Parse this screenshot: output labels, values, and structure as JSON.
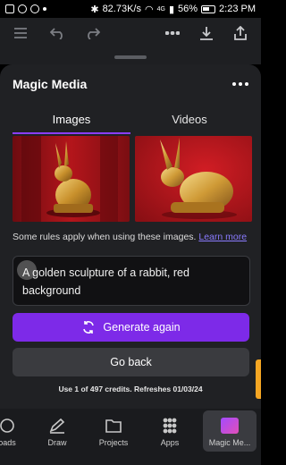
{
  "status_bar": {
    "speed": "82.73K/s",
    "network": "4G",
    "battery": "56%",
    "time": "2:23 PM"
  },
  "toolbar": {
    "icons": [
      "menu-icon",
      "undo-icon",
      "redo-icon",
      "more-icon",
      "download-icon",
      "share-icon"
    ]
  },
  "sheet": {
    "title": "Magic Media",
    "tabs": [
      {
        "label": "Images",
        "active": true
      },
      {
        "label": "Videos",
        "active": false
      }
    ],
    "rules_text": "Some rules apply when using these images.",
    "learn_more": "Learn more",
    "prompt": "A golden sculpture of a rabbit, red background",
    "generate_label": "Generate again",
    "back_label": "Go back",
    "credits": "Use 1 of 497 credits. Refreshes 01/03/24"
  },
  "bottom_nav": {
    "items": [
      {
        "label": "oads"
      },
      {
        "label": "Draw"
      },
      {
        "label": "Projects"
      },
      {
        "label": "Apps"
      },
      {
        "label": "Magic Me...",
        "active": true
      }
    ]
  },
  "colors": {
    "accent": "#7d2ae8",
    "sheet_bg": "#202124",
    "link": "#8a7bff"
  }
}
